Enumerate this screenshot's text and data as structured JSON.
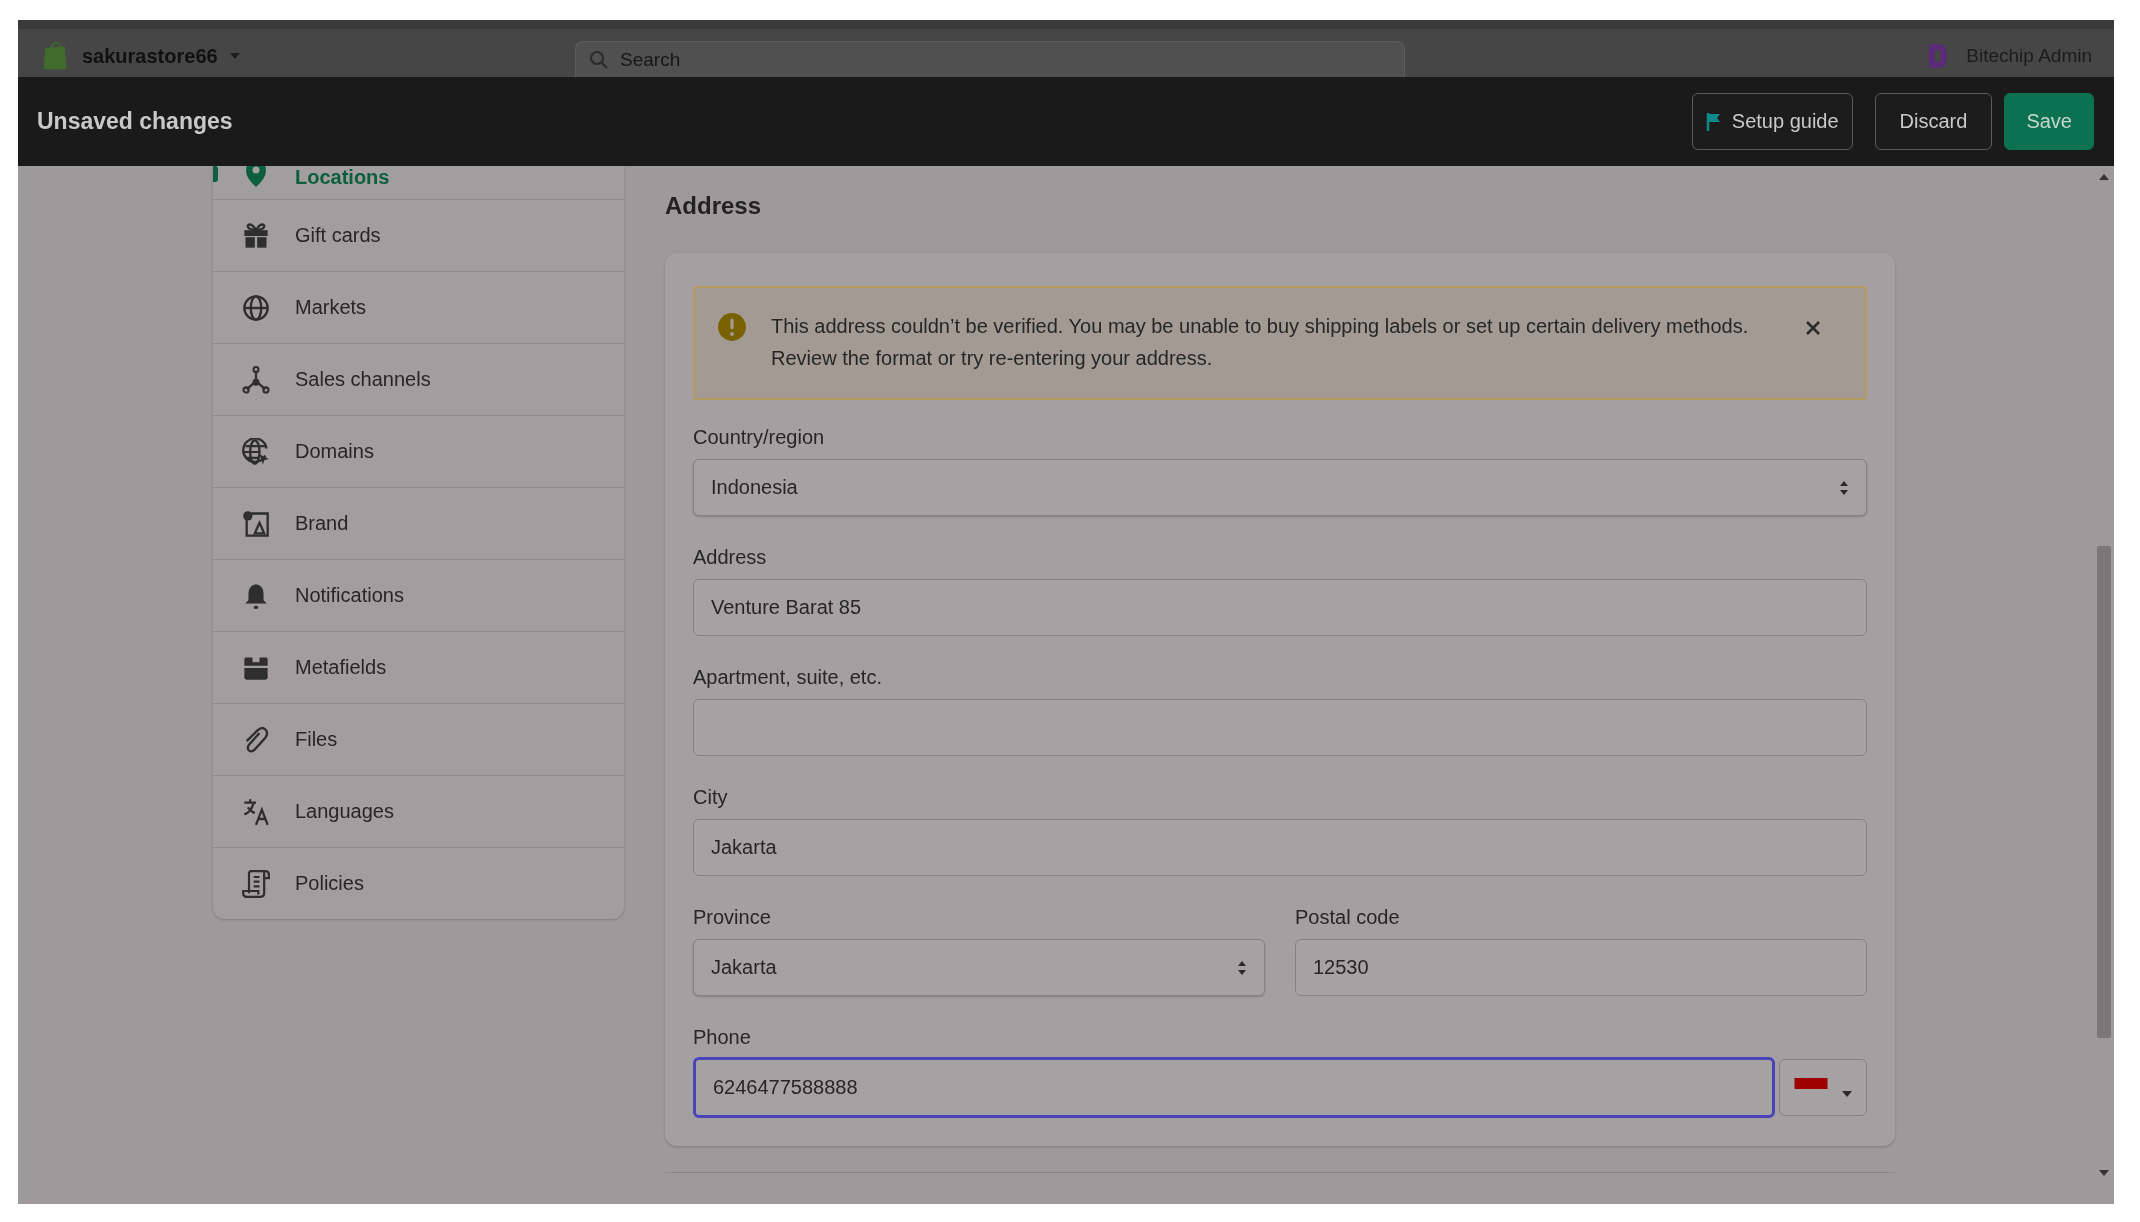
{
  "top_bar": {
    "store_name": "sakurastore66",
    "search": {
      "placeholder": "Search"
    },
    "account": "Bitechip Admin"
  },
  "unsaved_bar": {
    "title": "Unsaved changes",
    "buttons": [
      {
        "label": "Setup guide",
        "kind": "guide"
      },
      {
        "label": "Discard",
        "kind": "secondary"
      },
      {
        "label": "Save",
        "kind": "primary"
      }
    ]
  },
  "sidebar": {
    "items": [
      {
        "label": "Locations",
        "selected": true
      },
      {
        "label": "Gift cards",
        "selected": false
      },
      {
        "label": "Markets",
        "selected": false
      },
      {
        "label": "Sales channels",
        "selected": false
      },
      {
        "label": "Domains",
        "selected": false
      },
      {
        "label": "Brand",
        "selected": false
      },
      {
        "label": "Notifications",
        "selected": false
      },
      {
        "label": "Metafields",
        "selected": false
      },
      {
        "label": "Files",
        "selected": false
      },
      {
        "label": "Languages",
        "selected": false
      },
      {
        "label": "Policies",
        "selected": false
      }
    ]
  },
  "address": {
    "heading": "Address",
    "banner": {
      "message": "This address couldn’t be verified. You may be unable to buy shipping labels or set up certain delivery methods. Review the format or try re-entering your address."
    },
    "rows": [
      [
        {
          "label": "Country/region",
          "kind": "select",
          "value": "Indonesia"
        }
      ],
      [
        {
          "label": "Address",
          "kind": "text",
          "value": "Venture Barat 85"
        }
      ],
      [
        {
          "label": "Apartment, suite, etc.",
          "kind": "text"
        }
      ],
      [
        {
          "label": "City",
          "kind": "text",
          "value": "Jakarta"
        }
      ],
      [
        {
          "label": "Province",
          "kind": "select",
          "value": "Jakarta"
        },
        {
          "label": "Postal code",
          "kind": "text",
          "value": "12530"
        }
      ],
      [
        {
          "label": "Phone",
          "kind": "phone",
          "value": "6246477588888",
          "focused": true
        }
      ]
    ]
  }
}
